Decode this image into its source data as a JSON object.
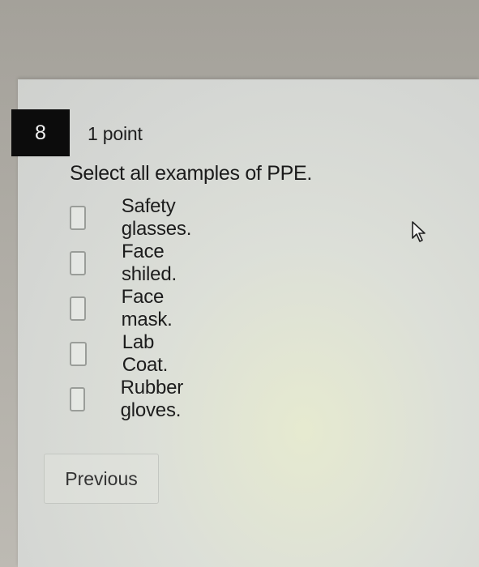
{
  "question": {
    "number": "8",
    "points": "1 point",
    "prompt": "Select all examples of PPE."
  },
  "choices": [
    {
      "label": "Safety glasses.",
      "checked": false
    },
    {
      "label": "Face shiled.",
      "checked": false
    },
    {
      "label": "Face mask.",
      "checked": false
    },
    {
      "label": "Lab Coat.",
      "checked": false
    },
    {
      "label": "Rubber gloves.",
      "checked": false
    }
  ],
  "navigation": {
    "previous_label": "Previous"
  },
  "icons": {
    "cursor": "mouse-pointer-icon"
  }
}
